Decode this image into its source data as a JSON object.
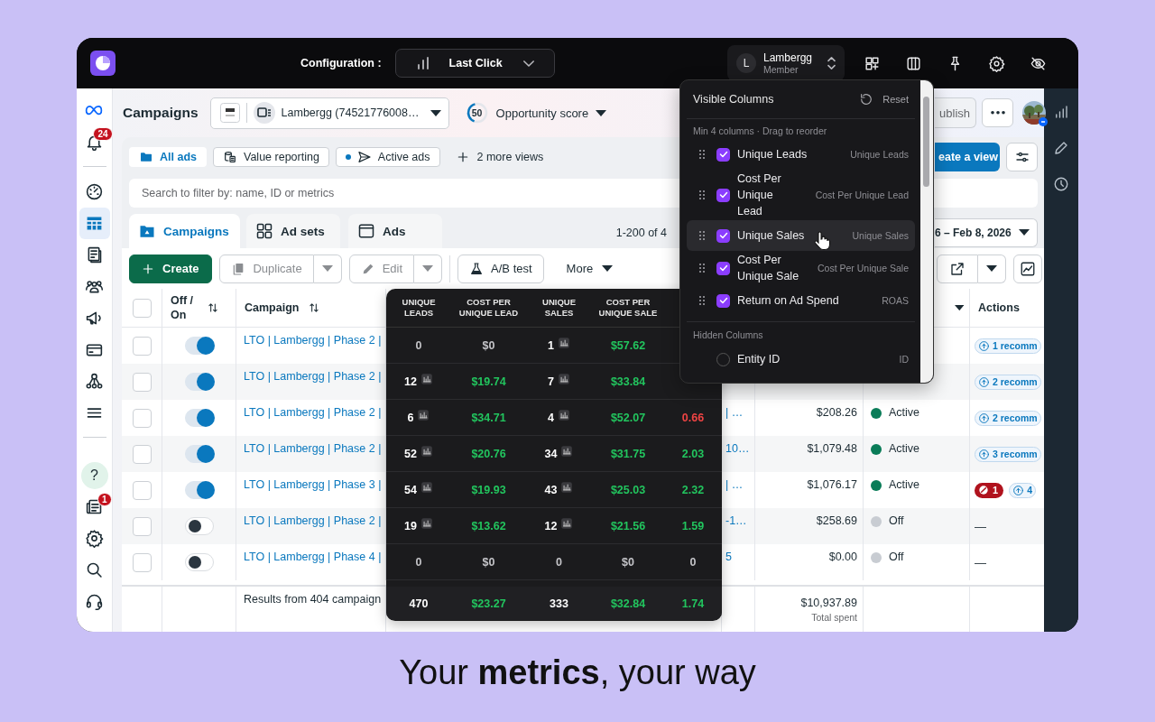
{
  "topbar": {
    "config_label": "Configuration :",
    "attribution": "Last Click",
    "account": {
      "initial": "L",
      "name": "Lambergg",
      "role": "Member"
    }
  },
  "nav": {
    "bell_badge": "24",
    "items": [
      {
        "selected": false
      },
      {
        "selected": true
      },
      {
        "selected": false
      },
      {
        "selected": false
      },
      {
        "selected": false
      },
      {
        "selected": false
      },
      {
        "selected": false
      },
      {
        "selected": false
      }
    ],
    "help": "?",
    "news_badge": "1"
  },
  "header": {
    "title": "Campaigns",
    "account": "Lambergg (74521776008…",
    "score": {
      "value": "50",
      "level": 0.4
    },
    "score_label": "Opportunity score",
    "publish": "ublish"
  },
  "views": [
    {
      "label": "All ads",
      "selected": true
    },
    {
      "label": "Value reporting",
      "selected": false
    },
    {
      "label": "Active ads",
      "selected": false
    }
  ],
  "more_views": "2 more views",
  "create_view": "eate a view",
  "search": {
    "placeholder": "Search to filter by: name, ID or metrics"
  },
  "level_tabs": [
    {
      "label": "Campaigns",
      "selected": true
    },
    {
      "label": "Ad sets",
      "selected": false
    },
    {
      "label": "Ads",
      "selected": false
    }
  ],
  "range": "1-200 of 4",
  "date_range": "6 – Feb 8, 2026",
  "toolbar": [
    {
      "kind": "primary",
      "label": "Create",
      "disabled": false
    },
    {
      "kind": "split",
      "label": "Duplicate",
      "disabled": true
    },
    {
      "kind": "split",
      "label": "Edit",
      "disabled": true
    },
    {
      "kind": "outline",
      "label": "A/B test",
      "disabled": false
    },
    {
      "kind": "menu",
      "label": "More",
      "disabled": false
    }
  ],
  "table": {
    "columns": {
      "toggle": "Off / On",
      "campaign": "Campaign",
      "actions": "Actions"
    },
    "select_all": {
      "checked": false
    },
    "rows": [
      {
        "checked": false,
        "on": true,
        "name": "LTO | Lambergg | Phase 2 |",
        "action": {
          "kind": "recs",
          "text": "1 recomm"
        }
      },
      {
        "checked": false,
        "on": true,
        "name": "LTO | Lambergg | Phase 2 |",
        "action": {
          "kind": "recs",
          "text": "2 recomm"
        }
      },
      {
        "checked": false,
        "on": true,
        "name": "LTO | Lambergg | Phase 2 |",
        "name_tail": "| …",
        "spend": "$208.26",
        "status": {
          "text": "Active",
          "color": "#0a7c58"
        },
        "action": {
          "kind": "recs",
          "text": "2 recomm"
        }
      },
      {
        "checked": false,
        "on": true,
        "name": "LTO | Lambergg | Phase 2 |",
        "name_tail": "10…",
        "spend": "$1,079.48",
        "status": {
          "text": "Active",
          "color": "#0a7c58"
        },
        "action": {
          "kind": "recs",
          "text": "3 recomm"
        }
      },
      {
        "checked": false,
        "on": true,
        "name": "LTO | Lambergg | Phase 3 |",
        "name_tail": "| …",
        "spend": "$1,076.17",
        "status": {
          "text": "Active",
          "color": "#0a7c58"
        },
        "action": {
          "kind": "issues",
          "alert": "1",
          "text": "4"
        }
      },
      {
        "checked": false,
        "on": false,
        "name": "LTO | Lambergg | Phase 2 |",
        "name_tail": "-1…",
        "spend": "$258.69",
        "status": {
          "text": "Off",
          "color": "#c8ccd2"
        },
        "action": {
          "kind": "none",
          "text": "—"
        }
      },
      {
        "checked": false,
        "on": false,
        "name": "LTO | Lambergg | Phase 4 |",
        "name_tail": "5",
        "spend": "$0.00",
        "status": {
          "text": "Off",
          "color": "#c8ccd2"
        },
        "action": {
          "kind": "none",
          "text": "—"
        }
      }
    ],
    "footer": {
      "summary": "Results from 404 campaign",
      "total": "$10,937.89",
      "total_label": "Total spent"
    }
  },
  "metrics": {
    "columns": [
      "UNIQUE LEADS",
      "COST PER UNIQUE LEAD",
      "UNIQUE SALES",
      "COST PER UNIQUE SALE"
    ],
    "rows": [
      {
        "leads": {
          "text": "0",
          "color": "#c4c4c8",
          "chart": false
        },
        "cpl": {
          "text": "$0",
          "color": "#c4c4c8"
        },
        "sales": {
          "text": "1",
          "color": "#ffffff",
          "chart": true
        },
        "cps": {
          "text": "$57.62",
          "color": "#22c55e"
        }
      },
      {
        "leads": {
          "text": "12",
          "color": "#ffffff",
          "chart": true
        },
        "cpl": {
          "text": "$19.74",
          "color": "#22c55e"
        },
        "sales": {
          "text": "7",
          "color": "#ffffff",
          "chart": true
        },
        "cps": {
          "text": "$33.84",
          "color": "#22c55e"
        }
      },
      {
        "leads": {
          "text": "6",
          "color": "#ffffff",
          "chart": true
        },
        "cpl": {
          "text": "$34.71",
          "color": "#22c55e"
        },
        "sales": {
          "text": "4",
          "color": "#ffffff",
          "chart": true
        },
        "cps": {
          "text": "$52.07",
          "color": "#22c55e"
        },
        "roas": {
          "text": "0.66",
          "color": "#ef4444"
        }
      },
      {
        "leads": {
          "text": "52",
          "color": "#ffffff",
          "chart": true
        },
        "cpl": {
          "text": "$20.76",
          "color": "#22c55e"
        },
        "sales": {
          "text": "34",
          "color": "#ffffff",
          "chart": true
        },
        "cps": {
          "text": "$31.75",
          "color": "#22c55e"
        },
        "roas": {
          "text": "2.03",
          "color": "#22c55e"
        }
      },
      {
        "leads": {
          "text": "54",
          "color": "#ffffff",
          "chart": true
        },
        "cpl": {
          "text": "$19.93",
          "color": "#22c55e"
        },
        "sales": {
          "text": "43",
          "color": "#ffffff",
          "chart": true
        },
        "cps": {
          "text": "$25.03",
          "color": "#22c55e"
        },
        "roas": {
          "text": "2.32",
          "color": "#22c55e"
        }
      },
      {
        "leads": {
          "text": "19",
          "color": "#ffffff",
          "chart": true
        },
        "cpl": {
          "text": "$13.62",
          "color": "#22c55e"
        },
        "sales": {
          "text": "12",
          "color": "#ffffff",
          "chart": true
        },
        "cps": {
          "text": "$21.56",
          "color": "#22c55e"
        },
        "roas": {
          "text": "1.59",
          "color": "#22c55e"
        }
      },
      {
        "leads": {
          "text": "0",
          "color": "#c4c4c8",
          "chart": false
        },
        "cpl": {
          "text": "$0",
          "color": "#c4c4c8"
        },
        "sales": {
          "text": "0",
          "color": "#c4c4c8",
          "chart": false
        },
        "cps": {
          "text": "$0",
          "color": "#c4c4c8"
        },
        "roas": {
          "text": "0",
          "color": "#c4c4c8"
        }
      }
    ],
    "totals": {
      "leads": {
        "text": "470",
        "color": "#ffffff",
        "chart": false
      },
      "cpl": {
        "text": "$23.27",
        "color": "#22c55e"
      },
      "sales": {
        "text": "333",
        "color": "#ffffff",
        "chart": false
      },
      "cps": {
        "text": "$32.84",
        "color": "#22c55e"
      },
      "roas": {
        "text": "1.74",
        "color": "#22c55e"
      }
    }
  },
  "columns_menu": {
    "title": "Visible Columns",
    "reset": "Reset",
    "hint": "Min 4 columns · Drag to reorder",
    "visible": [
      {
        "label": "Unique Leads",
        "short": "Unique Leads",
        "checked": true,
        "hovered": false
      },
      {
        "label": "Cost Per Unique Lead",
        "short": "Cost Per Unique Lead",
        "checked": true,
        "hovered": false
      },
      {
        "label": "Unique Sales",
        "short": "Unique Sales",
        "checked": true,
        "hovered": true
      },
      {
        "label": "Cost Per Unique Sale",
        "short": "Cost Per Unique Sale",
        "checked": true,
        "hovered": false
      },
      {
        "label": "Return on Ad Spend",
        "short": "ROAS",
        "checked": true,
        "hovered": false
      }
    ],
    "hidden_title": "Hidden Columns",
    "hidden": [
      {
        "label": "Entity ID",
        "short": "ID",
        "checked": false,
        "hovered": false
      }
    ]
  },
  "caption": "Your **metrics**, your way"
}
